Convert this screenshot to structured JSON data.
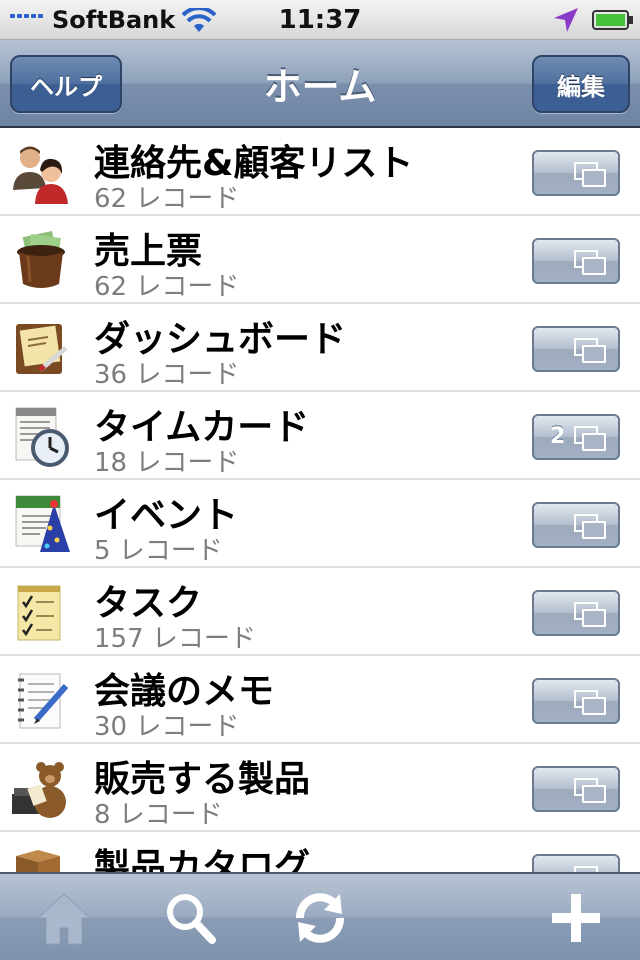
{
  "status_bar": {
    "carrier": "SoftBank",
    "time": "11:37"
  },
  "nav": {
    "title": "ホーム",
    "left_button": "ヘルプ",
    "right_button": "編集"
  },
  "records": [
    {
      "title": "連絡先&顧客リスト",
      "count": "62 レコード",
      "icon": "contacts-people-icon",
      "open_count": ""
    },
    {
      "title": "売上票",
      "count": "62 レコード",
      "icon": "money-hat-icon",
      "open_count": ""
    },
    {
      "title": "ダッシュボード",
      "count": "36 レコード",
      "icon": "dashboard-notepad-icon",
      "open_count": ""
    },
    {
      "title": "タイムカード",
      "count": "18 レコード",
      "icon": "timecard-clock-icon",
      "open_count": "2"
    },
    {
      "title": "イベント",
      "count": "5 レコード",
      "icon": "event-calendar-icon",
      "open_count": ""
    },
    {
      "title": "タスク",
      "count": "157 レコード",
      "icon": "task-checklist-icon",
      "open_count": ""
    },
    {
      "title": "会議のメモ",
      "count": "30 レコード",
      "icon": "meeting-notes-icon",
      "open_count": ""
    },
    {
      "title": "販売する製品",
      "count": "8 レコード",
      "icon": "products-teddy-icon",
      "open_count": ""
    },
    {
      "title": "製品カタログ",
      "count": "",
      "icon": "catalog-boxes-icon",
      "open_count": ""
    }
  ],
  "tab_bar": {
    "icons": [
      "home-icon",
      "search-icon",
      "sync-icon",
      "add-icon"
    ]
  },
  "colors": {
    "nav_accent": "#6e84a3",
    "button_blue": "#3c5f94",
    "record_count_gray": "#7d7d7d"
  }
}
